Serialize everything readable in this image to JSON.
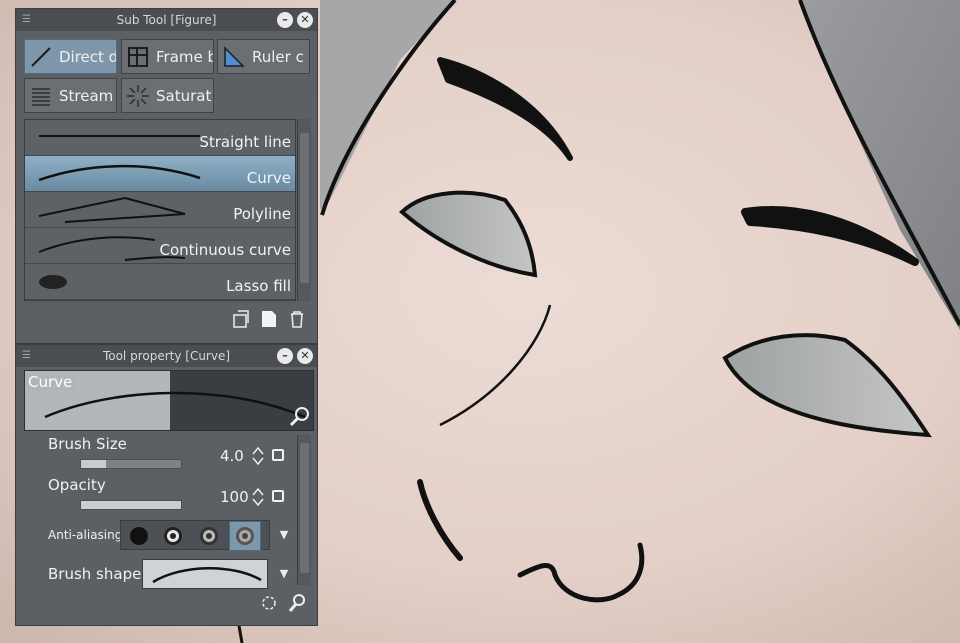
{
  "subtool_panel": {
    "title": "Sub Tool [Figure]",
    "tools": [
      {
        "label": "Direct d",
        "icon": "direct-draw-icon",
        "active": true
      },
      {
        "label": "Frame b",
        "icon": "frame-border-icon",
        "active": false
      },
      {
        "label": "Ruler c",
        "icon": "ruler-icon",
        "active": false
      },
      {
        "label": "Stream",
        "icon": "stream-line-icon",
        "active": false
      },
      {
        "label": "Saturat",
        "icon": "saturated-line-icon",
        "active": false
      }
    ],
    "items": [
      {
        "label": "Straight line",
        "active": false
      },
      {
        "label": "Curve",
        "active": true
      },
      {
        "label": "Polyline",
        "active": false
      },
      {
        "label": "Continuous curve",
        "active": false
      },
      {
        "label": "Lasso fill",
        "active": false
      }
    ]
  },
  "toolprop_panel": {
    "title": "Tool property [Curve]",
    "preview_name": "Curve",
    "brush_size": {
      "label": "Brush Size",
      "value": "4.0",
      "level": 0.25
    },
    "opacity": {
      "label": "Opacity",
      "value": "100",
      "level": 1.0
    },
    "anti_aliasing": {
      "label": "Anti-aliasing",
      "options": [
        "none",
        "weak",
        "medium",
        "strong"
      ],
      "selected": 3
    },
    "brush_shape": {
      "label": "Brush shape"
    }
  },
  "colors": {
    "accent": "#7e97aa",
    "panel": "#5c5f63",
    "skin": "#e8d6cf",
    "hair": "#8e8f93"
  }
}
